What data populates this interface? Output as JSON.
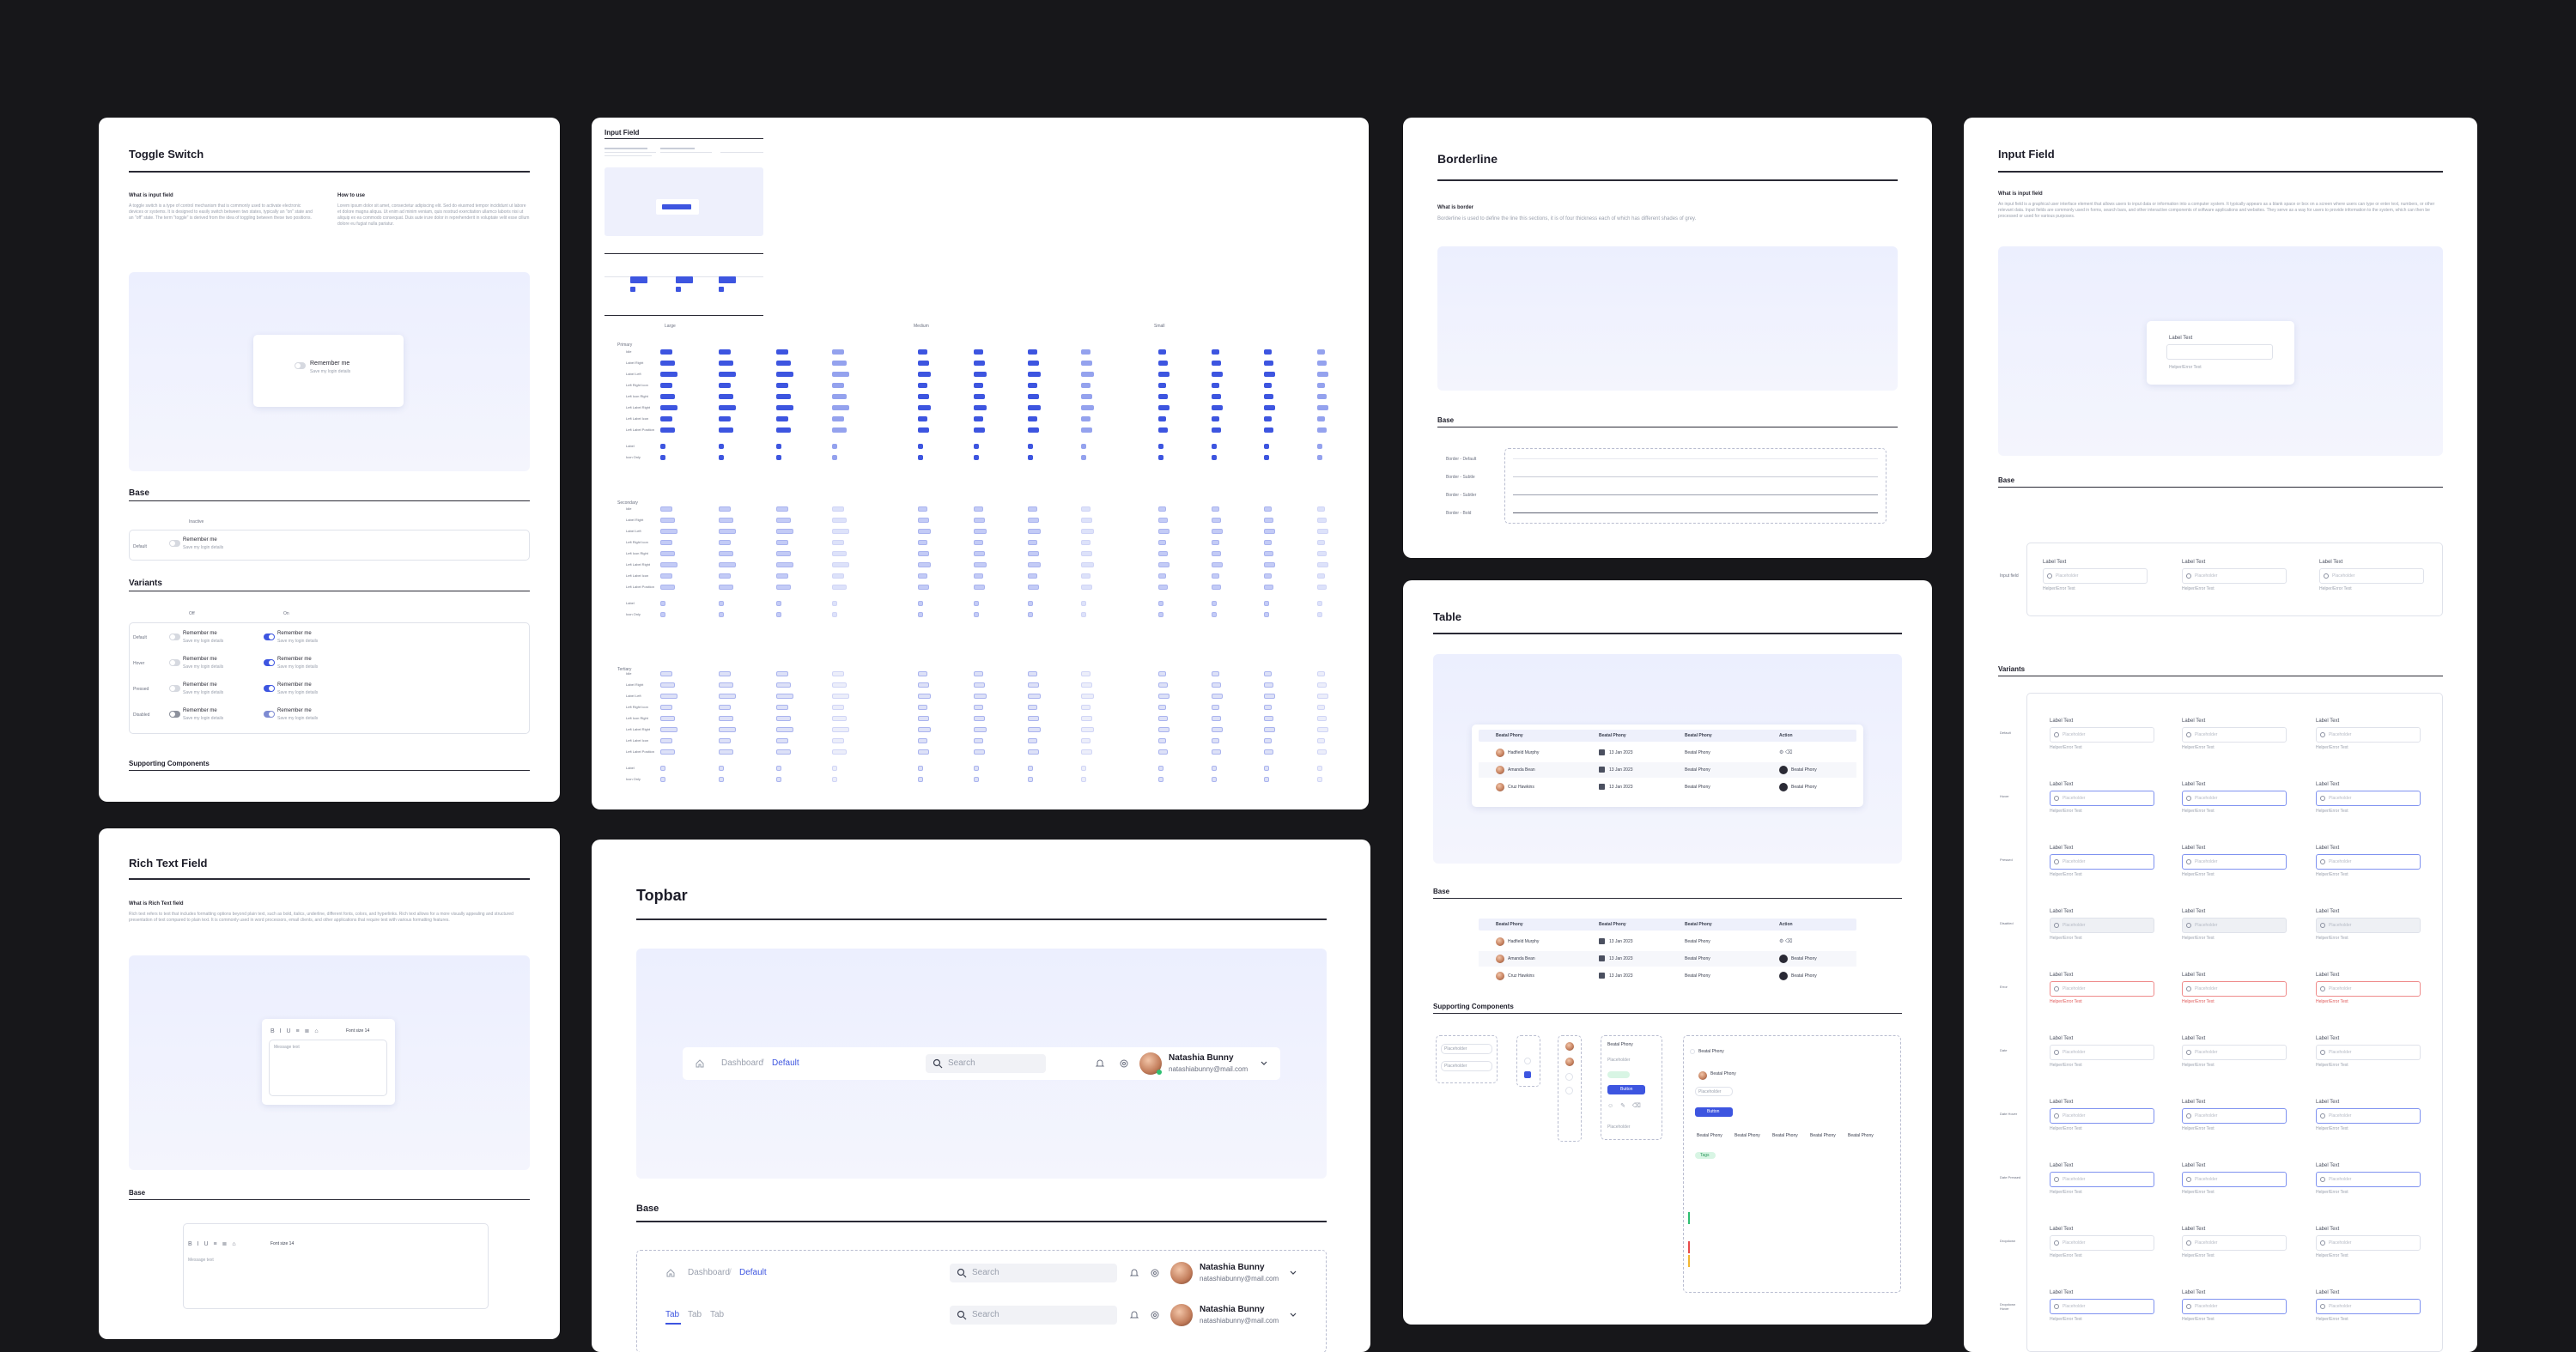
{
  "toggle_switch": {
    "title": "Toggle Switch",
    "what_heading": "What is input field",
    "what_body": "A toggle switch is a type of control mechanism that is commonly used to activate electronic devices or systems. It is designed to easily switch between two states, typically an \"on\" state and an \"off\" state. The term \"toggle\" is derived from the idea of toggling between these two positions.",
    "how_heading": "How to use",
    "how_body": "Lorem ipsum dolor sit amet, consectetur adipiscing elit. Sed do eiusmod tempor incididunt ut labore et dolore magna aliqua. Ut enim ad minim veniam, quis nostrud exercitation ullamco laboris nisi ut aliquip ex ea commodo consequat. Duis aute irure dolor in reprehenderit in voluptate velit esse cillum dolore eu fugiat nulla pariatur.",
    "preview_label": "Remember me",
    "preview_sub": "Save my login details",
    "base_heading": "Base",
    "base_col": "Inactive",
    "base_row": "Default",
    "variants_heading": "Variants",
    "variant_cols": [
      "Off",
      "On"
    ],
    "variant_rows": [
      "Default",
      "Hover",
      "Pressed",
      "Disabled"
    ],
    "supporting_heading": "Supporting Components"
  },
  "rich_text": {
    "title": "Rich Text Field",
    "what_heading": "What is Rich Text field",
    "what_body": "Rich text refers to text that includes formatting options beyond plain text, such as bold, italics, underline, different fonts, colors, and hyperlinks. Rich text allows for a more visually appealing and structured presentation of text compared to plain text. It is commonly used in word processors, email clients, and other applications that require text with various formatting features.",
    "toolbar_font": "Font size 14",
    "placeholder": "Message text",
    "base_heading": "Base"
  },
  "input_grid": {
    "title": "Input Field",
    "groups": [
      "Large",
      "Medium",
      "Small"
    ],
    "sections": [
      "Primary",
      "Secondary",
      "Tertiary"
    ],
    "row_labels": [
      "Idle",
      "Label Right",
      "Label Left",
      "Left Right Icon",
      "Left Icon Right",
      "Left Label Right",
      "Left Label Icon",
      "Left Label Position",
      "Label",
      "Icon Only"
    ]
  },
  "topbar": {
    "title": "Topbar",
    "breadcrumb_parent": "Dashboard",
    "breadcrumb_current": "Default",
    "search_placeholder": "Search",
    "user_name": "Natashia Bunny",
    "user_email": "natashiabunny@mail.com",
    "base_heading": "Base",
    "tabs": [
      "Tab",
      "Tab",
      "Tab"
    ]
  },
  "borderline": {
    "title": "Borderline",
    "what_heading": "What is border",
    "what_body": "Borderline is used to define the line this sections, it is of four thickness each of which has different shades of grey.",
    "base_heading": "Base",
    "rows": [
      "Border - Default",
      "Border - Subtle",
      "Border - Subtler",
      "Border - Bold"
    ]
  },
  "table": {
    "title": "Table",
    "headers": [
      "Beatal Phony",
      "Beatal Phony",
      "Beatal Phony",
      "Action"
    ],
    "rows": [
      {
        "name": "Hadfield Murphy",
        "date": "13 Jan 2023",
        "action": ""
      },
      {
        "name": "Amanda Bean",
        "date": "13 Jan 2023",
        "action": "Beatal Phony"
      },
      {
        "name": "Cruz Hawkins",
        "date": "13 Jan 2023",
        "action": "Beatal Phony"
      }
    ],
    "base_heading": "Base",
    "supporting_heading": "Supporting Components",
    "sc_placeholder": "Placeholder",
    "sc_button": "Button",
    "sc_item": "Beatal Phony",
    "sc_tag": "Tags",
    "sc_options": [
      "Beatal Phony",
      "Beatal Phony",
      "Beatal Phony",
      "Beatal Phony",
      "Beatal Phony"
    ]
  },
  "input_field": {
    "title": "Input Field",
    "what_heading": "What is input field",
    "what_body": "An input field is a graphical user interface element that allows users to input data or information into a computer system. It typically appears as a blank space or box on a screen where users can type or enter text, numbers, or other relevant data. Input fields are commonly used in forms, search bars, and other interactive components of software applications and websites. They serve as a way for users to provide information to the system, which can then be processed or used for various purposes.",
    "label": "Label Text",
    "placeholder": "Placeholder",
    "helper": "Helper/Error Text",
    "base_heading": "Base",
    "base_row": "Input field",
    "variants_heading": "Variants",
    "variant_rows": [
      "Default",
      "Hover",
      "Pressed",
      "Disabled",
      "Error",
      "Date",
      "Date Hover",
      "Date Pressed",
      "Dropdown",
      "Dropdown Hover"
    ]
  },
  "colors": {
    "background": "#17171a",
    "accent": "#3d55e0",
    "lavender": "#eceffe",
    "error": "#ef8b8b"
  }
}
